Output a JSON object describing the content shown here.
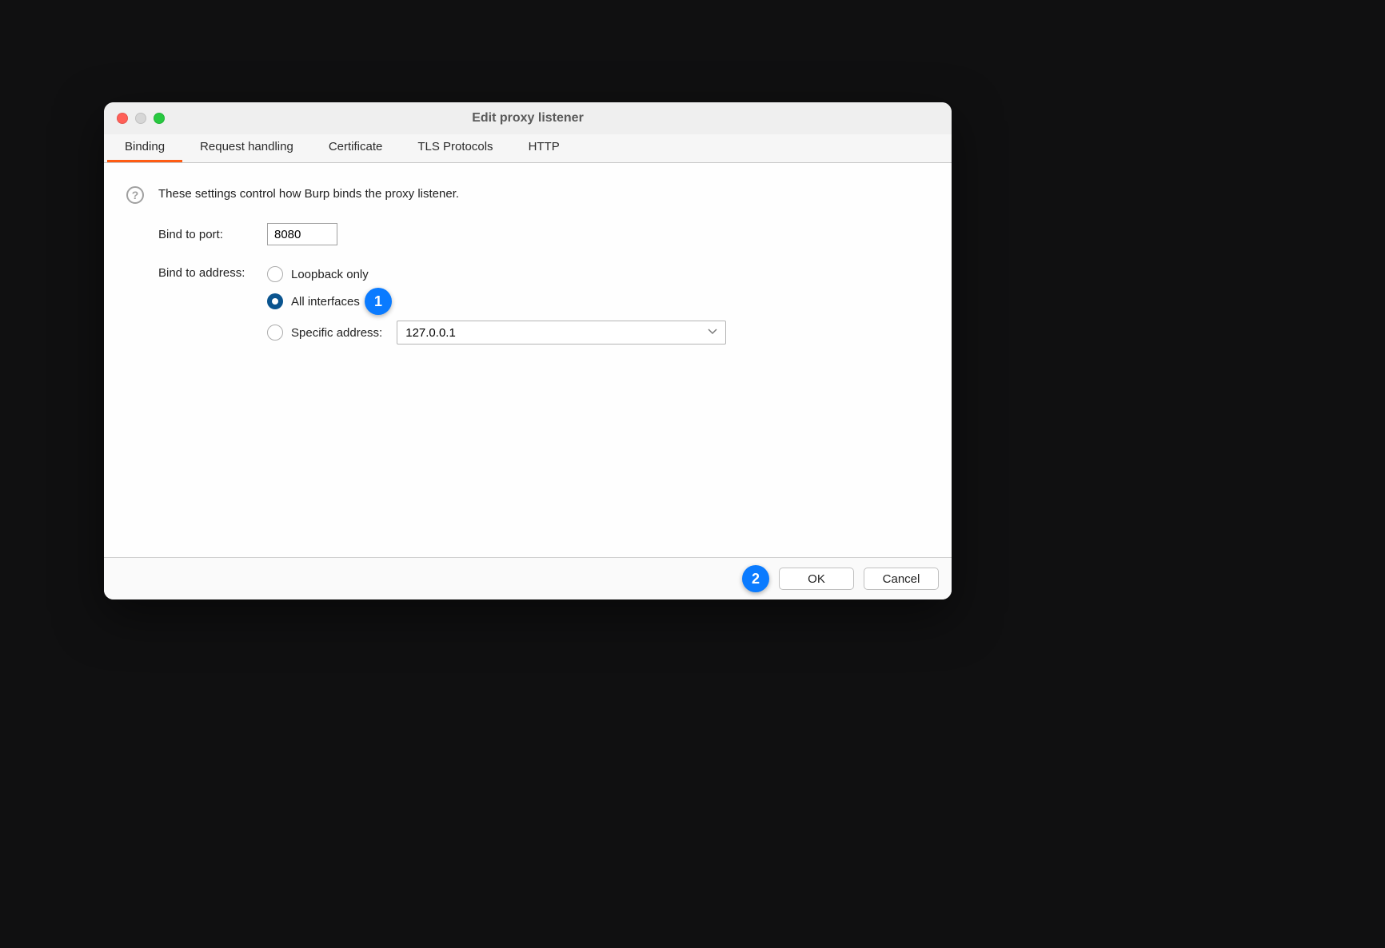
{
  "window": {
    "title": "Edit proxy listener"
  },
  "tabs": {
    "binding": "Binding",
    "request_handling": "Request handling",
    "certificate": "Certificate",
    "tls_protocols": "TLS Protocols",
    "http": "HTTP"
  },
  "help_glyph": "?",
  "description": "These settings control how Burp binds the proxy listener.",
  "form": {
    "bind_to_port_label": "Bind to port:",
    "bind_to_port_value": "8080",
    "bind_to_address_label": "Bind to address:",
    "radio_loopback": "Loopback only",
    "radio_all": "All interfaces",
    "radio_specific": "Specific address:",
    "specific_address_value": "127.0.0.1"
  },
  "footer": {
    "ok": "OK",
    "cancel": "Cancel"
  },
  "callouts": {
    "one": "1",
    "two": "2"
  }
}
